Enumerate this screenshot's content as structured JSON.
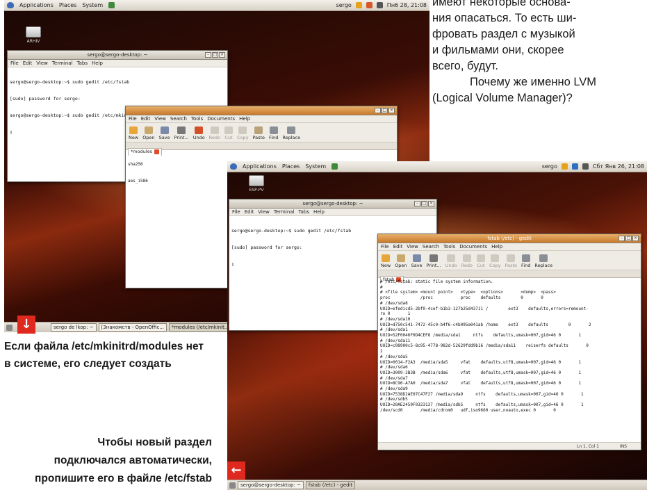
{
  "article": {
    "lines": [
      "имеют некоторые основа-",
      "ния опасаться. То есть ши-",
      "фровать раздел с музыкой",
      "и фильмами они, скорее",
      "всего, будут."
    ],
    "heading_lines": [
      "Почему же именно LVM",
      "(Logical Volume Manager)?"
    ]
  },
  "captions": {
    "top": "Если файла /etc/mkinitrd/modules нет в системе, его следует создать",
    "bottom": "Чтобы новый раздел подключался автоматически, пропишите его в файле /etc/fstab"
  },
  "arrows": {
    "down": "↓",
    "left": "←"
  },
  "desktop1": {
    "panel": {
      "menus": [
        "Applications",
        "Places",
        "System"
      ],
      "user": "sergo",
      "clock": "Пн6 28, 21:08"
    },
    "desktop_icon": "ARHIV",
    "terminal": {
      "title": "sergo@sergo-desktop: ~",
      "menus": [
        "File",
        "Edit",
        "View",
        "Terminal",
        "Tabs",
        "Help"
      ],
      "lines": [
        "sergo@sergo-desktop:~$ sudo gedit /etc/fstab",
        "[sudo] password for sergo:",
        "sergo@sergo-desktop:~$ sudo gedit /etc/mkinitrd/modules",
        "▯"
      ]
    },
    "gedit": {
      "menus": [
        "File",
        "Edit",
        "View",
        "Search",
        "Tools",
        "Documents",
        "Help"
      ],
      "toolbar": [
        "New",
        "Open",
        "Save",
        "Print...",
        "Undo",
        "Redo",
        "Cut",
        "Copy",
        "Paste",
        "Find",
        "Replace"
      ],
      "tab": "*modules",
      "lines": [
        "sha256",
        "aes_i586"
      ]
    },
    "taskbar": [
      "sergo de lkop: ~",
      "[Знакомств - OpenOffic...",
      "*modules (/etc/mkinit..."
    ]
  },
  "desktop2": {
    "panel": {
      "menus": [
        "Applications",
        "Places",
        "System"
      ],
      "user": "sergo",
      "clock": "Сбт Янв 26, 21:08"
    },
    "desktop_icon": "ESP-PV",
    "terminal": {
      "title": "sergo@sergo-desktop: ~",
      "menus": [
        "File",
        "Edit",
        "View",
        "Terminal",
        "Tabs",
        "Help"
      ],
      "lines": [
        "sergo@sergo-desktop:~$ sudo gedit /etc/fstab",
        "[sudo] password for sergo:",
        "▯"
      ]
    },
    "gedit": {
      "title": "fstab (/etc) - gedit",
      "menus": [
        "File",
        "Edit",
        "View",
        "Search",
        "Tools",
        "Documents",
        "Help"
      ],
      "toolbar": [
        "New",
        "Open",
        "Save",
        "Print...",
        "Undo",
        "Redo",
        "Cut",
        "Copy",
        "Paste",
        "Find",
        "Replace"
      ],
      "tab": "fstab",
      "lines": [
        "# /etc/fstab: static file system information.",
        "#",
        "# <file system> <mount point>   <type>  <options>       <dump>  <pass>",
        "proc            /proc           proc    defaults        0       0",
        "# /dev/sda8",
        "UUID=efedicd5-2bf0-4cef-b1b3-127b25d43711 /        ext3    defaults,errors=remount-",
        "ro 0       1",
        "# /dev/sda10",
        "UUID=d750c541-7472-45c0-b4f6-c4b095a041ab /home    ext3    defaults        0       2",
        "# /dev/sda1",
        "UUID=52F0046F0D4CEF8 /media/sda1     ntfs    defaults,umask=007,gid=46 0       1",
        "# /dev/sda11",
        "UUID=c08900c5-8c95-4778-982d-52629fdd9b16 /media/sda11    reiserfs defaults       0",
        "2",
        "# /dev/sda5",
        "UUID=0014-F2A3  /media/sda5     vfat    defaults,utf8,umask=007,gid=46 0       1",
        "# /dev/sda6",
        "UUID=3009-2B3B  /media/sda6     vfat    defaults,utf8,umask=007,gid=46 0       1",
        "# /dev/sda7",
        "UUID=8C96-A7A0  /media/sda7     vfat    defaults,utf8,umask=007,gid=46 0       1",
        "# /dev/sda9",
        "UUID=7538D2AE07C47F27 /media/sda9     ntfs    defaults,umask=007,gid=46 0       1",
        "# /dev/sdb5",
        "UUID=20AE2459F0323137 /media/sdb5     ntfs    defaults,umask=007,gid=46 0       1",
        "/dev/scd0       /media/cdrom0   udf,iso9660 user,noauto,exec 0       0"
      ],
      "status": {
        "position": "Ln 1, Col 1",
        "mode": "INS"
      }
    },
    "taskbar": [
      "sergo@sergo-desktop: ~",
      "fstab (/etc) - gedit"
    ]
  },
  "colors": {
    "accent_red": "#e0291e",
    "gnome_orange": "#c87a2c"
  }
}
